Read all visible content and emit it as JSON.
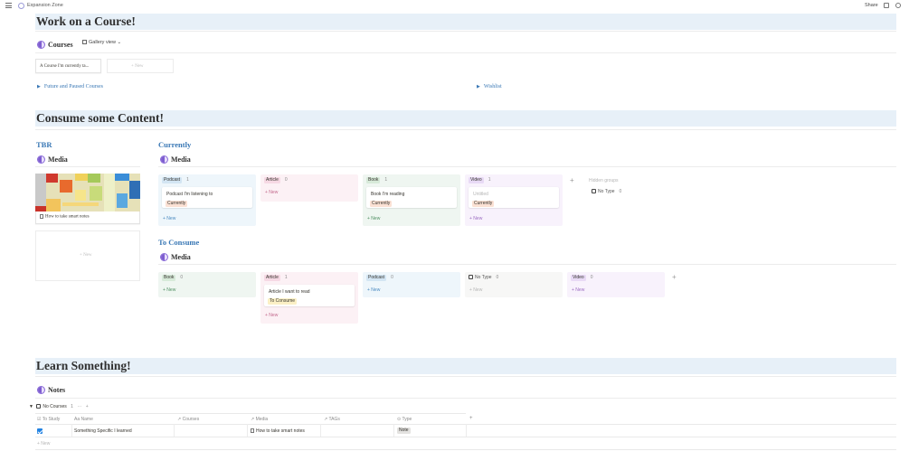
{
  "topbar": {
    "page_title": "Expansion Zone",
    "share": "Share"
  },
  "sections": {
    "course": {
      "heading": "Work on a Course!"
    },
    "consume": {
      "heading": "Consume some Content!"
    },
    "learn": {
      "heading": "Learn Something!"
    }
  },
  "courses_db": {
    "title": "Courses",
    "view": "Gallery view",
    "card_title": "A Course I'm currently ta...",
    "new_label": "+ New",
    "toggle_future": "Future and Paused Courses",
    "toggle_wishlist": "Wishlist"
  },
  "tbr": {
    "heading": "TBR",
    "db_title": "Media",
    "card_title": "How to take smart notes",
    "new_label": "+ New"
  },
  "currently": {
    "heading": "Currently",
    "db_title": "Media",
    "columns": [
      {
        "tag": "Podcast",
        "count": "1",
        "card": "Podcast I'm listening to",
        "status": "Currently",
        "new": "+ New"
      },
      {
        "tag": "Article",
        "count": "0",
        "new": "+ New"
      },
      {
        "tag": "Book",
        "count": "1",
        "card": "Book I'm reading",
        "status": "Currently",
        "new": "+ New"
      },
      {
        "tag": "Video",
        "count": "1",
        "card": "Untitled",
        "status": "Currently",
        "new": "+ New"
      }
    ],
    "hidden_groups": "Hidden groups",
    "no_type": "No Type",
    "no_type_count": "0"
  },
  "to_consume": {
    "heading": "To Consume",
    "db_title": "Media",
    "columns": [
      {
        "tag": "Book",
        "count": "0",
        "new": "+ New"
      },
      {
        "tag": "Article",
        "count": "1",
        "card": "Article I want to read",
        "status": "To Consume",
        "new": "+ New"
      },
      {
        "tag": "Podcast",
        "count": "0",
        "new": "+ New"
      },
      {
        "tag": "No Type",
        "count": "0",
        "new": "+ New"
      },
      {
        "tag": "Video",
        "count": "0",
        "new": "+ New"
      }
    ]
  },
  "notes": {
    "db_title": "Notes",
    "group_label": "No Courses",
    "group_count": "1",
    "group_more": "···",
    "group_add": "+",
    "columns": [
      "To Study",
      "Name",
      "Courses",
      "Media",
      "TAGs",
      "Type"
    ],
    "row": {
      "name": "Something Specific I learned",
      "media": "How to take smart notes",
      "type": "Note"
    },
    "new_label": "+ New"
  },
  "colors": {
    "heading_band": "#e7f0f8",
    "section_blue": "#3a78b5",
    "podcast_bg": "#eef6fb",
    "article_bg": "#fcf1f5",
    "book_bg": "#eff6f1",
    "video_bg": "#f8f2fc",
    "status_currently": "#fbe1d4",
    "status_to_consume": "#fbf0c5"
  }
}
